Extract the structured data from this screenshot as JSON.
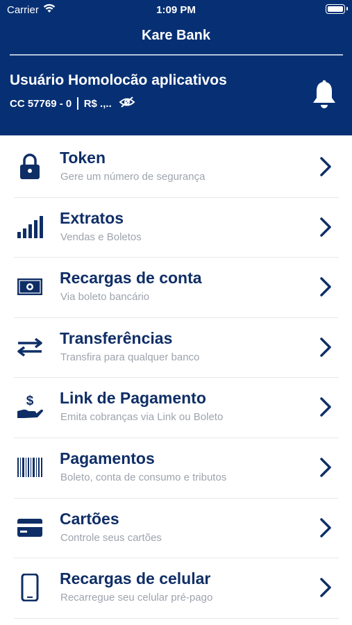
{
  "status_bar": {
    "carrier": "Carrier",
    "time": "1:09 PM"
  },
  "header": {
    "title": "Kare Bank",
    "user_name": "Usuário Homolocão aplicativos",
    "account": "CC 57769 - 0",
    "balance": "R$ .,.."
  },
  "colors": {
    "brand": "#073074",
    "label": "#0f2e66",
    "subtitle": "#9ea3ad"
  },
  "menu": [
    {
      "icon": "lock-icon",
      "label": "Token",
      "subtitle": "Gere um número de segurança"
    },
    {
      "icon": "signal-bars-icon",
      "label": "Extratos",
      "subtitle": "Vendas e Boletos"
    },
    {
      "icon": "banknote-icon",
      "label": "Recargas de conta",
      "subtitle": "Via boleto bancário"
    },
    {
      "icon": "transfer-arrows-icon",
      "label": "Transferências",
      "subtitle": "Transfira para qualquer banco"
    },
    {
      "icon": "hand-money-icon",
      "label": "Link de Pagamento",
      "subtitle": "Emita cobranças via Link ou Boleto"
    },
    {
      "icon": "barcode-icon",
      "label": "Pagamentos",
      "subtitle": "Boleto, conta de consumo e tributos"
    },
    {
      "icon": "credit-card-icon",
      "label": "Cartões",
      "subtitle": "Controle seus cartões"
    },
    {
      "icon": "mobile-phone-icon",
      "label": "Recargas de celular",
      "subtitle": "Recarregue seu celular pré-pago"
    }
  ]
}
